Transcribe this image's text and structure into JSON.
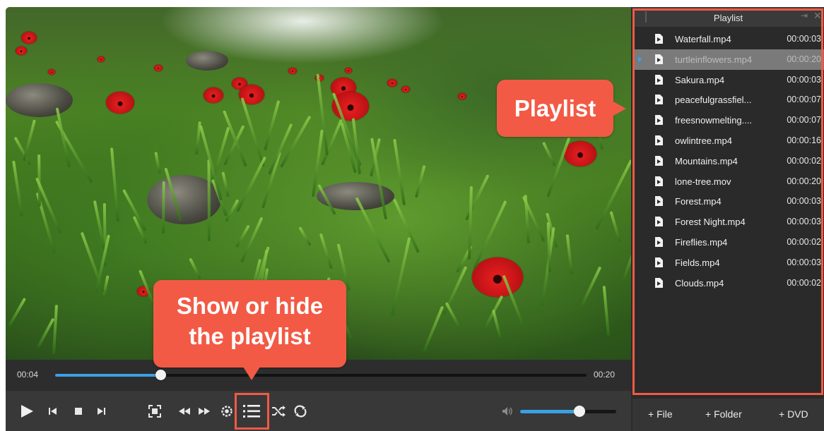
{
  "player": {
    "current_time": "00:04",
    "total_time": "00:20",
    "progress": 0.2,
    "volume": 0.62
  },
  "controls": [
    "play",
    "previous",
    "stop",
    "next",
    "fullscreen",
    "rewind",
    "fast-forward",
    "settings",
    "playlist-toggle",
    "shuffle",
    "repeat",
    "volume"
  ],
  "playlist": {
    "title": "Playlist",
    "active_index": 1,
    "items": [
      {
        "name": "Waterfall.mp4",
        "duration": "00:00:03"
      },
      {
        "name": "turtleinflowers.mp4",
        "duration": "00:00:20"
      },
      {
        "name": "Sakura.mp4",
        "duration": "00:00:03"
      },
      {
        "name": "peacefulgrassfiel...",
        "duration": "00:00:07"
      },
      {
        "name": "freesnowmelting....",
        "duration": "00:00:07"
      },
      {
        "name": "owlintree.mp4",
        "duration": "00:00:16"
      },
      {
        "name": "Mountains.mp4",
        "duration": "00:00:02"
      },
      {
        "name": "lone-tree.mov",
        "duration": "00:00:20"
      },
      {
        "name": "Forest.mp4",
        "duration": "00:00:03"
      },
      {
        "name": "Forest Night.mp4",
        "duration": "00:00:03"
      },
      {
        "name": "Fireflies.mp4",
        "duration": "00:00:02"
      },
      {
        "name": "Fields.mp4",
        "duration": "00:00:03"
      },
      {
        "name": "Clouds.mp4",
        "duration": "00:00:02"
      }
    ],
    "footer": {
      "add_file": "+ File",
      "add_folder": "+ Folder",
      "add_dvd": "+ DVD"
    }
  },
  "annotations": {
    "playlist_callout": "Playlist",
    "toggle_callout_line1": "Show or hide",
    "toggle_callout_line2": "the playlist"
  },
  "colors": {
    "accent": "#f25a45",
    "progress": "#3aa0e6"
  }
}
